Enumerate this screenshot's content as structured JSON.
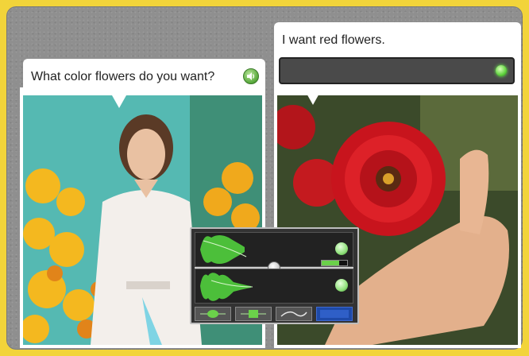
{
  "prompt": {
    "question": "What color flowers do you want?",
    "speaker_icon": "speaker-icon"
  },
  "answer": {
    "text": "I want red flowers.",
    "mic_status_icon": "microphone-status-light-icon"
  },
  "wave_panel": {
    "level_meter_fraction": 0.7,
    "mode_buttons": [
      "waveform-icon",
      "pitch-icon",
      "curve-icon",
      "spectrum-icon"
    ],
    "active_mode_index": 3
  },
  "colors": {
    "page_border": "#f2d43a",
    "panel_background": "#8f8f8f",
    "accent_green": "#57a83a",
    "active_mode_blue": "#1e4aa8"
  }
}
